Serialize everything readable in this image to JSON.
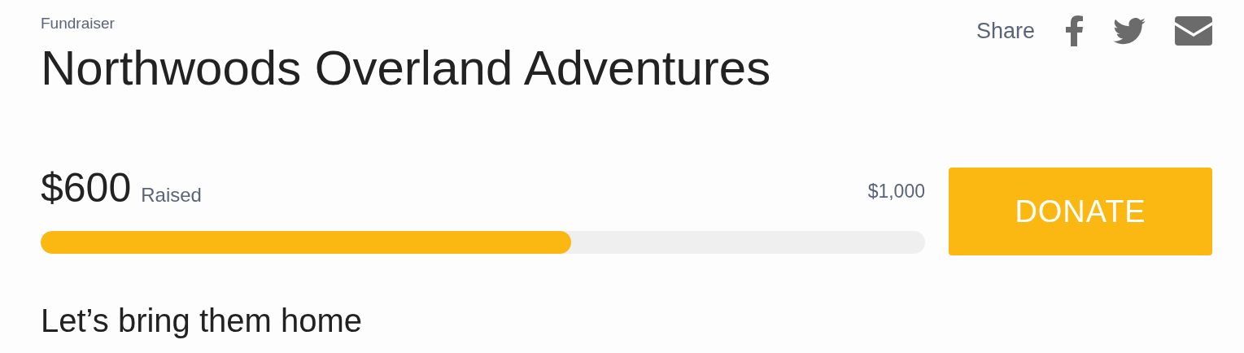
{
  "header": {
    "eyebrow": "Fundraiser",
    "title": "Northwoods Overland Adventures"
  },
  "share": {
    "label": "Share",
    "icons": [
      {
        "kind": "facebook"
      },
      {
        "kind": "twitter"
      },
      {
        "kind": "mail"
      }
    ]
  },
  "progress": {
    "raised_amount": "$600",
    "raised_label": "Raised",
    "goal": "$1,000",
    "level": 0.6
  },
  "donate_button": "DONATE",
  "story_heading": "Let’s bring them home"
}
